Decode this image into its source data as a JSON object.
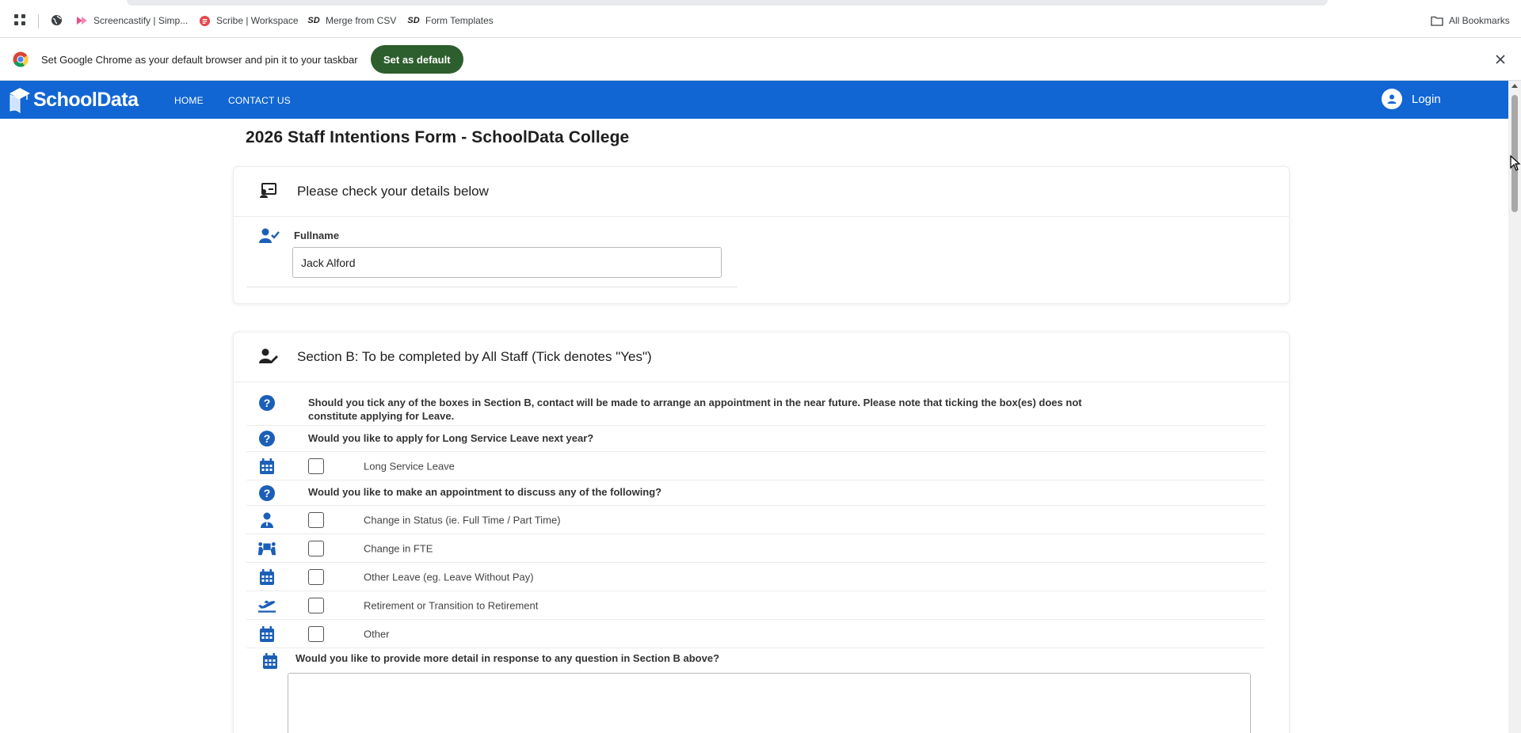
{
  "bookmarks_bar": {
    "items": [
      {
        "label": "Screencastify | Simp...",
        "icon": "screencastify-icon"
      },
      {
        "label": "Scribe | Workspace",
        "icon": "scribe-icon"
      },
      {
        "label": "Merge from CSV",
        "icon": "schooldata-icon"
      },
      {
        "label": "Form Templates",
        "icon": "schooldata-icon"
      }
    ],
    "all_bookmarks": "All Bookmarks",
    "schooldata_glyph": "SD"
  },
  "infobar": {
    "message": "Set Google Chrome as your default browser and pin it to your taskbar",
    "button": "Set as default"
  },
  "nav": {
    "logo_text": "SchoolData",
    "links": [
      "HOME",
      "CONTACT US"
    ],
    "login": "Login",
    "accent": "#1166d4"
  },
  "page": {
    "title": "2026 Staff Intentions Form - SchoolData College"
  },
  "details_card": {
    "title": "Please check your details below",
    "fullname_label": "Fullname",
    "fullname_value": "Jack Alford"
  },
  "section_b": {
    "title": "Section B: To be completed by All Staff (Tick denotes \"Yes\")",
    "note_line1": "Should you tick any of the boxes in Section B, contact will be made to arrange an appointment in the near future. Please note that ticking the box(es) does not",
    "note_line2": "constitute applying for Leave.",
    "q1": "Would you like to apply for Long Service Leave next year?",
    "q1_option": "Long Service Leave",
    "q2": "Would you like to make an appointment to discuss any of the following?",
    "q2_options": [
      {
        "label": "Change in Status (ie. Full Time / Part Time)",
        "icon": "person-icon",
        "checked": false
      },
      {
        "label": "Change in FTE",
        "icon": "people-carry-icon",
        "checked": false
      },
      {
        "label": "Other Leave (eg. Leave Without Pay)",
        "icon": "calendar-icon",
        "checked": false
      },
      {
        "label": "Retirement or Transition to Retirement",
        "icon": "plane-departure-icon",
        "checked": false
      },
      {
        "label": "Other",
        "icon": "calendar-icon",
        "checked": false
      }
    ],
    "q3": "Would you like to provide more detail in response to any question in Section B above?",
    "q3_value": ""
  }
}
